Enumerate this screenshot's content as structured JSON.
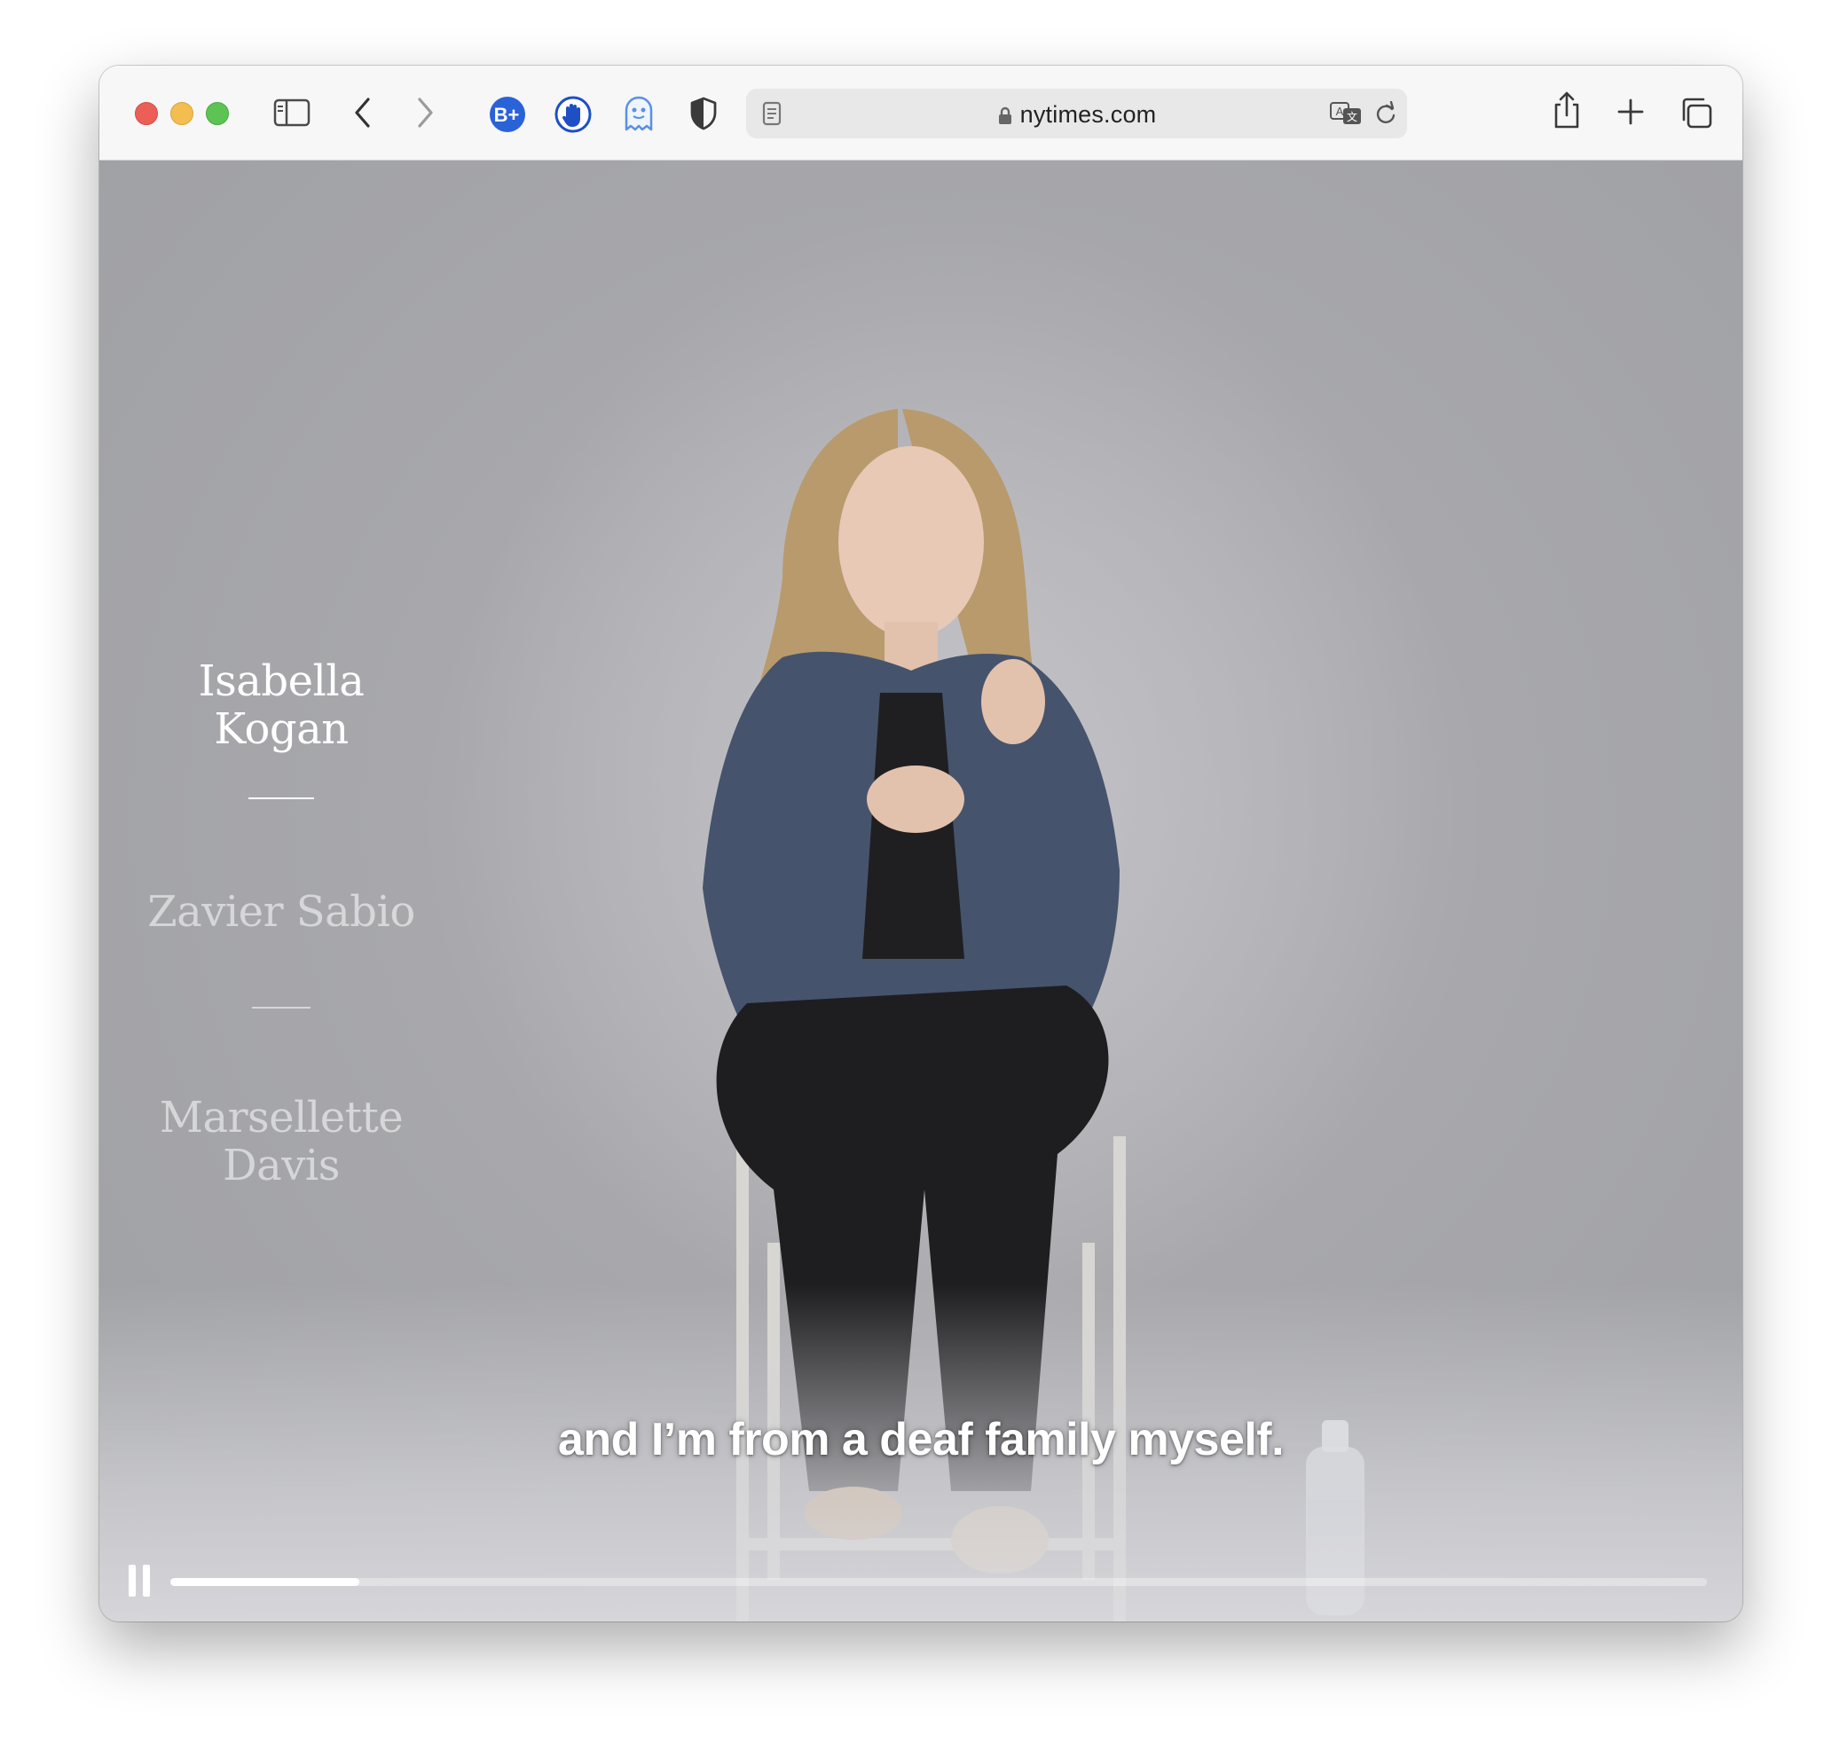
{
  "browser": {
    "url": "nytimes.com",
    "extensions": [
      "b-plus-icon",
      "hand-stop-icon",
      "ghost-icon",
      "shield-icon"
    ]
  },
  "speakers": [
    "Isabella Kogan",
    "Zavier Sabio",
    "Marsellette Davis"
  ],
  "active_speaker_index": 0,
  "video": {
    "caption": "and I’m from a deaf family myself.",
    "progress": 0.123,
    "playing": true
  },
  "colors": {
    "accent_blue": "#2a62d8",
    "progress_fill": "#ffffff"
  }
}
